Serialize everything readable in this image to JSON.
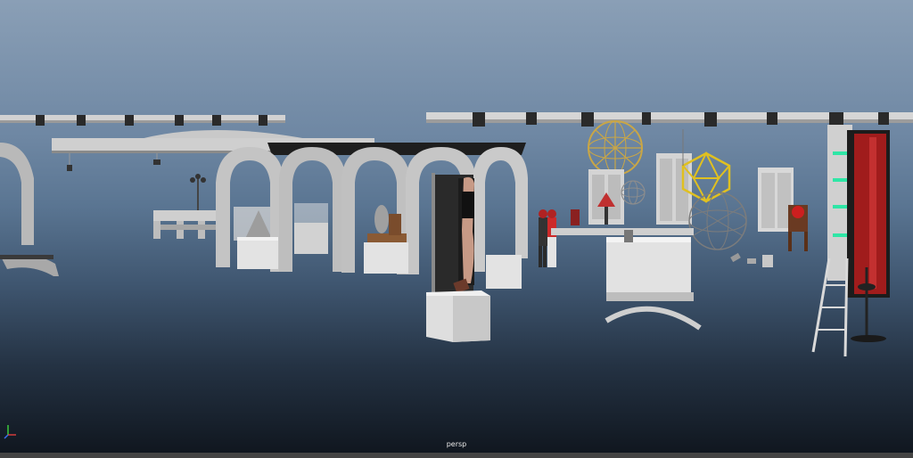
{
  "viewport": {
    "camera_label": "persp",
    "bg_top": "#8a9fb6",
    "bg_bottom": "#0f151d"
  },
  "axis_gizmo": {
    "x_color": "#d23c3c",
    "y_color": "#3cc83c",
    "z_color": "#3c6ef0"
  }
}
